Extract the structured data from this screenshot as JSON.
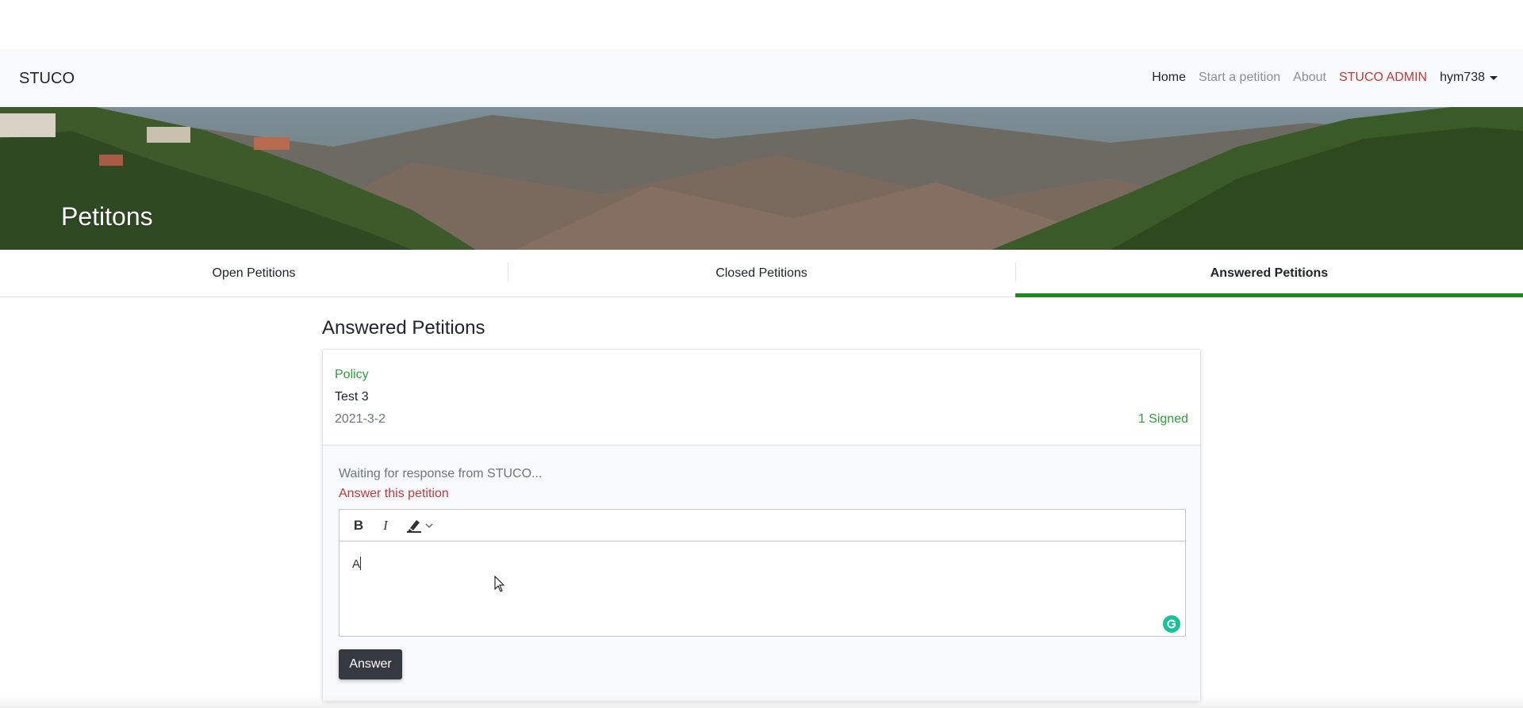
{
  "navbar": {
    "brand": "STUCO",
    "links": {
      "home": "Home",
      "start": "Start a petition",
      "about": "About",
      "admin": "STUCO ADMIN",
      "user": "hym738"
    }
  },
  "hero": {
    "title": "Petitons"
  },
  "tabs": {
    "open": "Open Petitions",
    "closed": "Closed Petitions",
    "answered": "Answered Petitions",
    "active": "answered"
  },
  "main": {
    "heading": "Answered Petitions",
    "petition": {
      "category": "Policy",
      "title": "Test 3",
      "date": "2021-3-2",
      "signed": "1 Signed",
      "status": "Waiting for response from STUCO...",
      "answer_link": "Answer this petition",
      "editor": {
        "toolbar": {
          "bold": "B",
          "italic": "I",
          "highlight_icon": "highlighter-icon"
        },
        "value": "A",
        "grammarly_icon": "grammarly-icon"
      },
      "answer_button": "Answer"
    }
  },
  "colors": {
    "accent_green": "#1a8a1a",
    "category_green": "#2e9e3e",
    "admin_red": "#c0393b",
    "button_dark": "#343a40"
  }
}
